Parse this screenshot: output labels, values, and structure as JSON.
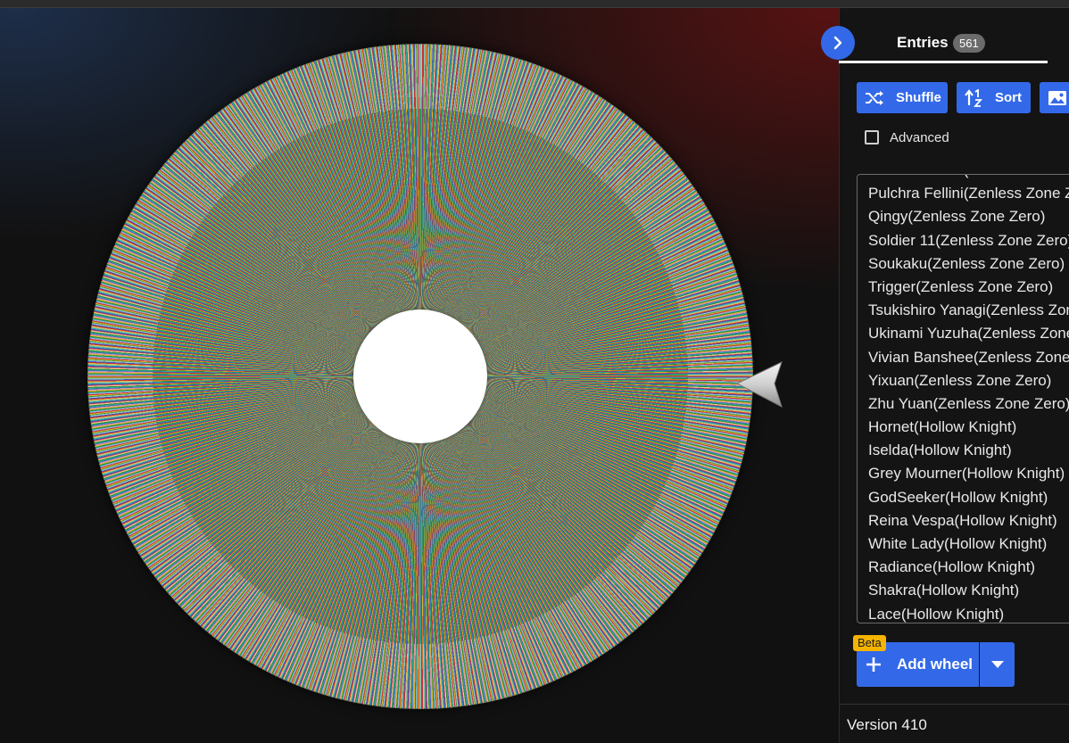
{
  "sidebar": {
    "tab_label": "Entries",
    "entries_count": "561",
    "shuffle_label": "Shuffle",
    "sort_label": "Sort",
    "advanced_label": "Advanced",
    "entries": [
      "Pulchra Fellini(Zenless Zone Zero)",
      "Pulchra Fellini(Zenless Zone Zero)",
      "Qingy(Zenless Zone Zero)",
      "Soldier 11(Zenless Zone Zero)",
      "Soukaku(Zenless Zone Zero)",
      "Trigger(Zenless Zone Zero)",
      "Tsukishiro Yanagi(Zenless Zone Zero)",
      "Ukinami Yuzuha(Zenless Zone Zero)",
      "Vivian Banshee(Zenless Zone Zero)",
      "Yixuan(Zenless Zone Zero)",
      "Zhu Yuan(Zenless Zone Zero)",
      "Hornet(Hollow Knight)",
      "Iselda(Hollow Knight)",
      "Grey Mourner(Hollow Knight)",
      "GodSeeker(Hollow Knight)",
      "Reina Vespa(Hollow Knight)",
      "White Lady(Hollow Knight)",
      "Radiance(Hollow Knight)",
      "Shakra(Hollow Knight)",
      "Lace(Hollow Knight)"
    ],
    "beta_label": "Beta",
    "add_wheel_label": "Add wheel",
    "version": "Version 410"
  },
  "icons": {
    "collapse": "chevron-right-icon",
    "shuffle": "shuffle-icon",
    "sort": "sort-icon",
    "image": "image-icon",
    "add": "plus-icon",
    "dropdown": "caret-down-icon"
  },
  "colors": {
    "accent": "#3369e8",
    "badge": "#f5b400",
    "wheel_segments": [
      "#2e8b3a",
      "#d7b52b",
      "#cc3333",
      "#4553b8",
      "#2aa6a0"
    ]
  }
}
